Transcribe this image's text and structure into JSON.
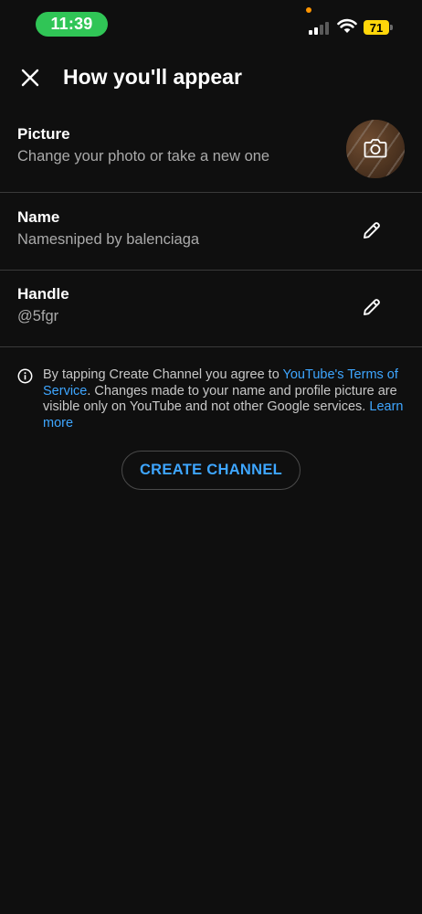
{
  "status_bar": {
    "time": "11:39",
    "battery_level": "71",
    "colors": {
      "time_pill": "#30c556",
      "battery": "#ffd60a",
      "mic_indicator": "#ff9500"
    }
  },
  "header": {
    "title": "How you'll appear",
    "close_icon": "close-icon"
  },
  "picture": {
    "label": "Picture",
    "hint": "Change your photo or take a new one",
    "icon": "camera-icon"
  },
  "name": {
    "label": "Name",
    "value": "Namesniped by balenciaga",
    "icon": "pencil-icon"
  },
  "handle": {
    "label": "Handle",
    "value": "@5fgr",
    "icon": "pencil-icon"
  },
  "notice": {
    "icon": "info-icon",
    "text_1": "By tapping Create Channel you agree to ",
    "tos_link": "YouTube's Terms of Service",
    "text_2": ". Changes made to your name and profile picture are visible only on YouTube and not other Google services. ",
    "learn_more": "Learn more"
  },
  "create_button": {
    "label": "CREATE CHANNEL"
  },
  "colors": {
    "background": "#0f0f0f",
    "link": "#3ea6ff",
    "divider": "#3a3a3a",
    "secondary_text": "#aaaaaa"
  }
}
